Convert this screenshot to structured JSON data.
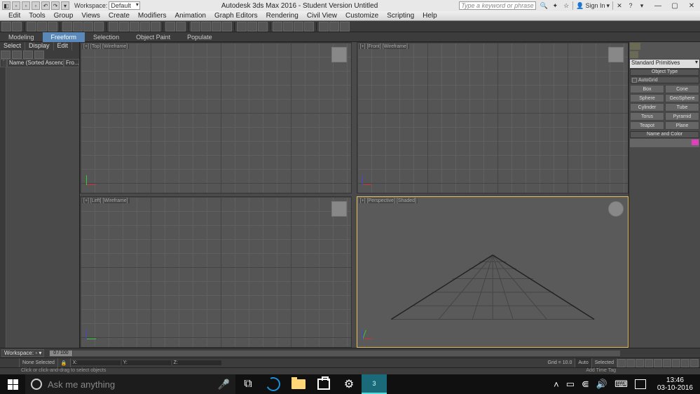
{
  "titlebar": {
    "ws_label": "Workspace:",
    "ws_value": "Default",
    "title": "Autodesk 3ds Max 2016 - Student Version   Untitled",
    "search_placeholder": "Type a keyword or phrase",
    "sign_in": "Sign In"
  },
  "menu": [
    "Edit",
    "Tools",
    "Group",
    "Views",
    "Create",
    "Modifiers",
    "Animation",
    "Graph Editors",
    "Rendering",
    "Civil View",
    "Customize",
    "Scripting",
    "Help"
  ],
  "ribbon": {
    "tabs": [
      "Modeling",
      "Freeform",
      "Selection",
      "Object Paint",
      "Populate"
    ],
    "active_index": 1
  },
  "scene_explorer": {
    "tabs": [
      "Select",
      "Display",
      "Edit"
    ],
    "columns": [
      "Name (Sorted Ascending)",
      "Fro..."
    ],
    "ico_col": "⬛"
  },
  "viewports": {
    "top": "[+] [Top] [Wireframe]",
    "front": "[+] [Front] [Wireframe]",
    "left": "[+] [Left] [Wireframe]",
    "persp": "[+] [Perspective] [Shaded]"
  },
  "command_panel": {
    "category": "Standard Primitives",
    "rollout_objtype": "Object Type",
    "autogrid": "AutoGrid",
    "buttons": [
      [
        "Box",
        "Cone"
      ],
      [
        "Sphere",
        "GeoSphere"
      ],
      [
        "Cylinder",
        "Tube"
      ],
      [
        "Torus",
        "Pyramid"
      ],
      [
        "Teapot",
        "Plane"
      ]
    ],
    "rollout_namecolor": "Name and Color",
    "swatch": "#e040c0"
  },
  "timeline": {
    "ws": "Workspace:",
    "frame": "0 / 100"
  },
  "status": {
    "sel": "None Selected",
    "hint": "Click or click-and-drag to select objects",
    "x": "X:",
    "y": "Y:",
    "z": "Z:",
    "grid": "Grid = 10.0",
    "auto": "Auto",
    "addtime": "Add Time Tag",
    "selected2": "Selected"
  },
  "taskbar": {
    "cortana": "Ask me anything",
    "time": "13:46",
    "date": "03-10-2016"
  }
}
